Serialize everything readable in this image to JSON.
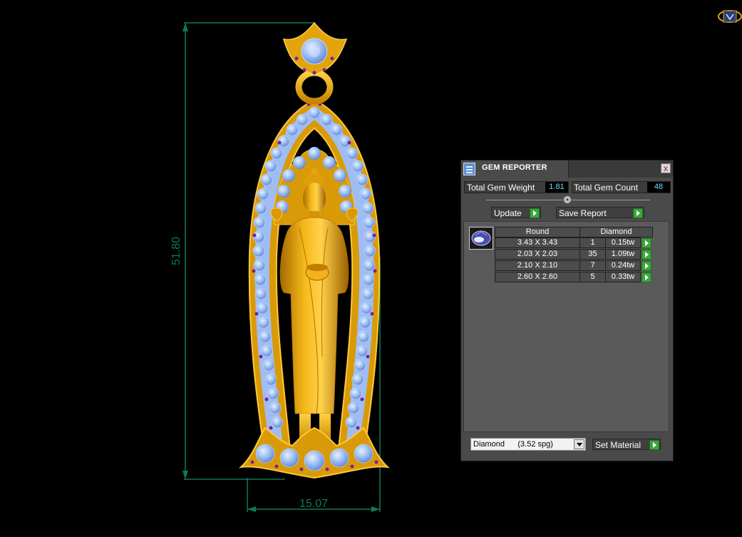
{
  "dimensions": {
    "height_label": "51.80",
    "width_label": "15.07"
  },
  "gem_reporter": {
    "title": "GEM REPORTER",
    "close_label": "x",
    "total_gem_weight": {
      "label": "Total Gem Weight",
      "value": "1.81"
    },
    "total_gem_count": {
      "label": "Total Gem Count",
      "value": "48"
    },
    "update_label": "Update",
    "save_report_label": "Save Report",
    "table": {
      "shape_header": "Round",
      "material_header": "Diamond",
      "rows": [
        {
          "size": "3.43 X 3.43",
          "count": "1",
          "weight": "0.15tw"
        },
        {
          "size": "2.03 X 2.03",
          "count": "35",
          "weight": "1.09tw"
        },
        {
          "size": "2.10 X 2.10",
          "count": "7",
          "weight": "0.24tw"
        },
        {
          "size": "2.60 X 2.60",
          "count": "5",
          "weight": "0.33tw"
        }
      ]
    },
    "material_select": {
      "name": "Diamond",
      "spec": "(3.52 spg)"
    },
    "set_material_label": "Set Material"
  },
  "colors": {
    "dimension_line": "#0f7a55",
    "gold": "#e7a80c",
    "gem_blue": "#8fb6f4",
    "accent_gem": "#7a1f9a",
    "value_text": "#6fd8ff"
  }
}
